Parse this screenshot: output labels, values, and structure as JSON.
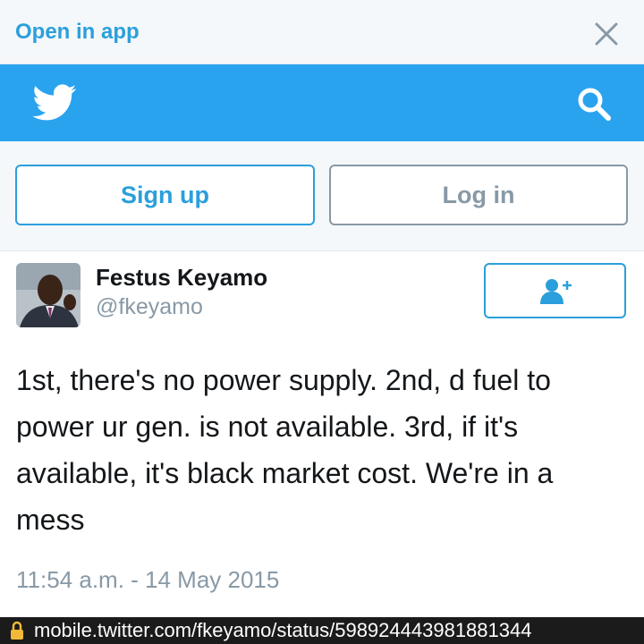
{
  "banner": {
    "open_in_app": "Open in app",
    "close_icon": "close-icon"
  },
  "nav": {
    "logo_icon": "twitter-bird-icon",
    "search_icon": "search-icon",
    "brand_color": "#2aa3ef"
  },
  "auth": {
    "signup_label": "Sign up",
    "login_label": "Log in"
  },
  "tweet": {
    "display_name": "Festus Keyamo",
    "username": "@fkeyamo",
    "follow_icon": "add-user-icon",
    "text": "1st, there's no power supply. 2nd, d fuel to power ur gen. is not available. 3rd, if it's available, it's black market cost. We're in a mess",
    "timestamp": "11:54 a.m. - 14 May 2015"
  },
  "browser": {
    "lock_icon": "lock-icon",
    "url": "mobile.twitter.com/fkeyamo/status/598924443981881344"
  }
}
